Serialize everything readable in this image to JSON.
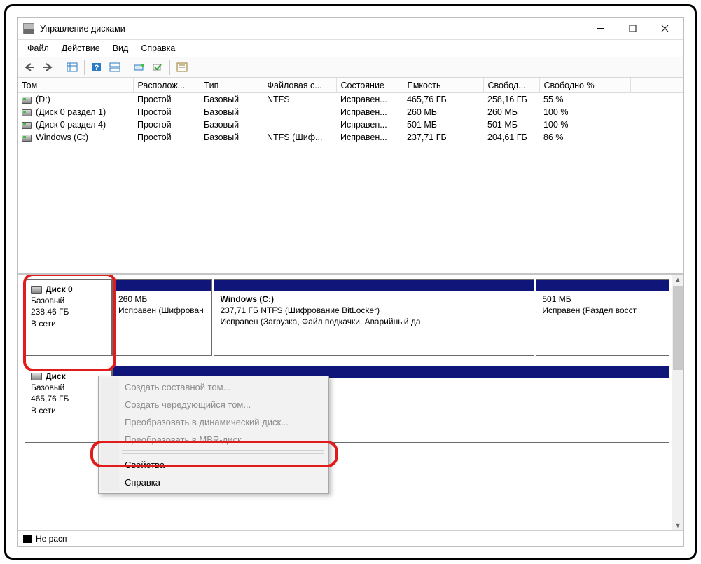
{
  "window": {
    "title": "Управление дисками"
  },
  "menu": {
    "file": "Файл",
    "action": "Действие",
    "view": "Вид",
    "help": "Справка"
  },
  "columns": {
    "volume": "Том",
    "layout": "Располож...",
    "type": "Тип",
    "fs": "Файловая с...",
    "status": "Состояние",
    "capacity": "Емкость",
    "free": "Свобод...",
    "freepct": "Свободно %"
  },
  "volumes": [
    {
      "name": "(D:)",
      "layout": "Простой",
      "type": "Базовый",
      "fs": "NTFS",
      "status": "Исправен...",
      "capacity": "465,76 ГБ",
      "free": "258,16 ГБ",
      "freepct": "55 %"
    },
    {
      "name": "(Диск 0 раздел 1)",
      "layout": "Простой",
      "type": "Базовый",
      "fs": "",
      "status": "Исправен...",
      "capacity": "260 МБ",
      "free": "260 МБ",
      "freepct": "100 %"
    },
    {
      "name": "(Диск 0 раздел 4)",
      "layout": "Простой",
      "type": "Базовый",
      "fs": "",
      "status": "Исправен...",
      "capacity": "501 МБ",
      "free": "501 МБ",
      "freepct": "100 %"
    },
    {
      "name": "Windows (C:)",
      "layout": "Простой",
      "type": "Базовый",
      "fs": "NTFS (Шиф...",
      "status": "Исправен...",
      "capacity": "237,71 ГБ",
      "free": "204,61 ГБ",
      "freepct": "86 %"
    }
  ],
  "disks": [
    {
      "name": "Диск 0",
      "type": "Базовый",
      "size": "238,46 ГБ",
      "status": "В сети",
      "parts": [
        {
          "title": "",
          "line1": "260 МБ",
          "line2": "Исправен (Шифрован",
          "flex": 18
        },
        {
          "title": "Windows  (C:)",
          "line1": "237,71 ГБ NTFS (Шифрование BitLocker)",
          "line2": "Исправен (Загрузка, Файл подкачки, Аварийный да",
          "flex": 58
        },
        {
          "title": "",
          "line1": "501 МБ",
          "line2": "Исправен (Раздел восст",
          "flex": 24
        }
      ]
    },
    {
      "name": "Диск",
      "type": "Базовый",
      "size": "465,76 ГБ",
      "status": "В сети",
      "parts": [
        {
          "title": "",
          "line1": "",
          "line2": "",
          "flex": 100
        }
      ]
    }
  ],
  "legend": {
    "unalloc": "Не расп"
  },
  "context": {
    "items": [
      {
        "label": "Создать составной том...",
        "enabled": false
      },
      {
        "label": "Создать чередующийся том...",
        "enabled": false
      },
      {
        "label": "Преобразовать в динамический диск...",
        "enabled": false
      },
      {
        "label": "Преобразовать в MBR-диск",
        "enabled": false
      },
      {
        "label": "Свойства",
        "enabled": true
      },
      {
        "label": "Справка",
        "enabled": true
      }
    ]
  }
}
